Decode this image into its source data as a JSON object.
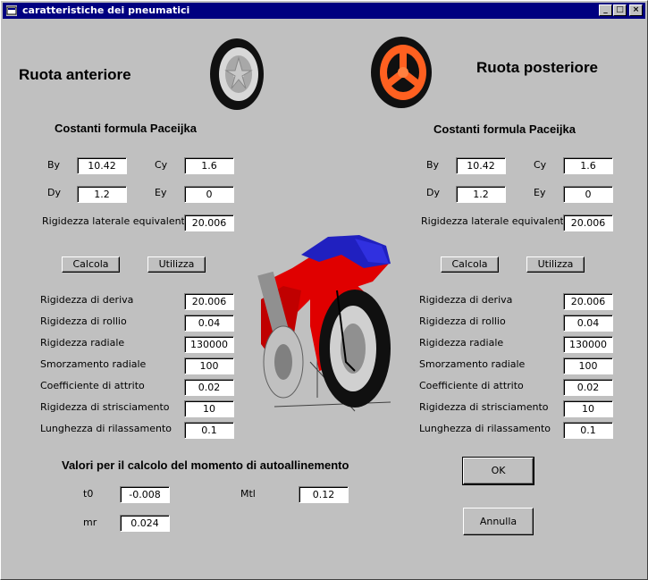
{
  "window": {
    "title": "caratteristiche dei pneumatici"
  },
  "front": {
    "title": "Ruota anteriore",
    "section": "Costanti formula Paceijka",
    "By": {
      "label": "By",
      "value": "10.42"
    },
    "Cy": {
      "label": "Cy",
      "value": "1.6"
    },
    "Dy": {
      "label": "Dy",
      "value": "1.2"
    },
    "Ey": {
      "label": "Ey",
      "value": "0"
    },
    "rig_lat": {
      "label": "Rigidezza laterale equivalente",
      "value": "20.006"
    },
    "calcola": "Calcola",
    "utilizza": "Utilizza",
    "params": [
      {
        "label": "Rigidezza di deriva",
        "value": "20.006"
      },
      {
        "label": "Rigidezza di rollio",
        "value": "0.04"
      },
      {
        "label": "Rigidezza radiale",
        "value": "130000"
      },
      {
        "label": "Smorzamento radiale",
        "value": "100"
      },
      {
        "label": "Coefficiente di attrito",
        "value": "0.02"
      },
      {
        "label": "Rigidezza di strisciamento",
        "value": "10"
      },
      {
        "label": "Lunghezza di rilassamento",
        "value": "0.1"
      }
    ]
  },
  "rear": {
    "title": "Ruota posteriore",
    "section": "Costanti formula Paceijka",
    "By": {
      "label": "By",
      "value": "10.42"
    },
    "Cy": {
      "label": "Cy",
      "value": "1.6"
    },
    "Dy": {
      "label": "Dy",
      "value": "1.2"
    },
    "Ey": {
      "label": "Ey",
      "value": "0"
    },
    "rig_lat": {
      "label": "Rigidezza laterale equivalente",
      "value": "20.006"
    },
    "calcola": "Calcola",
    "utilizza": "Utilizza",
    "params": [
      {
        "label": "Rigidezza di deriva",
        "value": "20.006"
      },
      {
        "label": "Rigidezza di rollio",
        "value": "0.04"
      },
      {
        "label": "Rigidezza radiale",
        "value": "130000"
      },
      {
        "label": "Smorzamento radiale",
        "value": "100"
      },
      {
        "label": "Coefficiente di attrito",
        "value": "0.02"
      },
      {
        "label": "Rigidezza di strisciamento",
        "value": "10"
      },
      {
        "label": "Lunghezza di rilassamento",
        "value": "0.1"
      }
    ]
  },
  "autoall": {
    "title": "Valori per il calcolo del momento di autoallinemento",
    "t0": {
      "label": "t0",
      "value": "-0.008"
    },
    "mr": {
      "label": "mr",
      "value": "0.024"
    },
    "mtl": {
      "label": "Mtl",
      "value": "0.12"
    }
  },
  "buttons": {
    "ok": "OK",
    "annulla": "Annulla"
  },
  "colors": {
    "titlebar": "#000080",
    "face": "#c0c0c0",
    "bike_red": "#e00000",
    "bike_blue": "#2020c0",
    "rear_wheel": "#ff6020"
  }
}
